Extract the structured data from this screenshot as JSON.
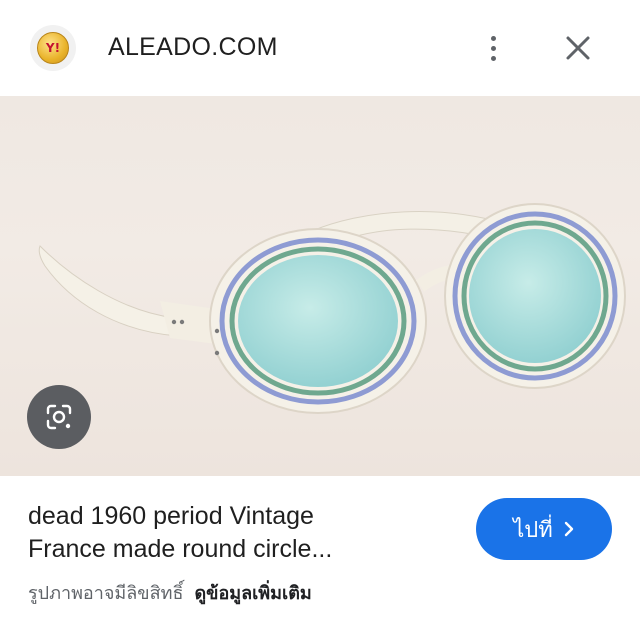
{
  "header": {
    "site_name": "ALEADO.COM",
    "logo_text": "Y!",
    "icons": [
      "site-logo-icon",
      "more-vert-icon",
      "close-icon"
    ]
  },
  "image": {
    "subject": "vintage white round sunglasses with blue lenses",
    "lens_button_icon": "google-lens-icon"
  },
  "result": {
    "title_line1": "dead 1960 period Vintage",
    "title_line2": "France made round circle...",
    "copyright_text": "รูปภาพอาจมีลิขสิทธิ์",
    "more_info_label": "ดูข้อมูลเพิ่มเติม",
    "visit_label": "ไปที่",
    "visit_icon": "chevron-right-icon"
  },
  "colors": {
    "accent": "#1a73e8",
    "lens_button": "#5b5d61"
  }
}
